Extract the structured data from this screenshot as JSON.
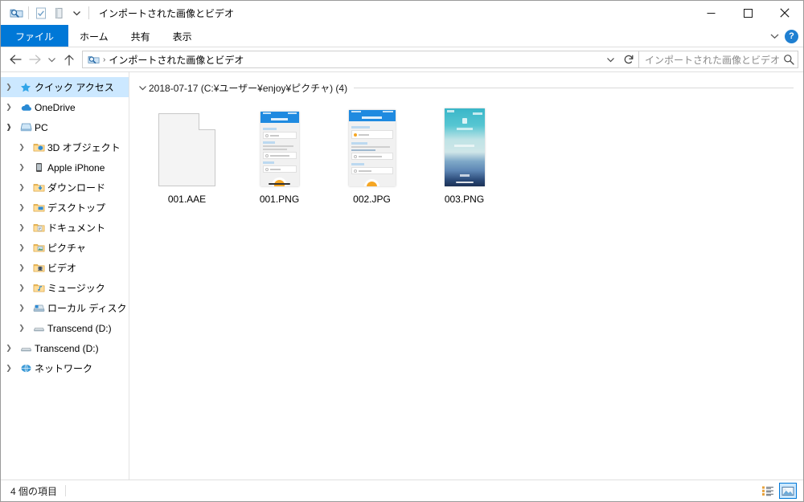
{
  "window": {
    "title": "インポートされた画像とビデオ",
    "quick_access_icons": [
      "saved-search-folder-icon",
      "properties-icon",
      "new-folder-icon",
      "customize-dropdown-icon"
    ],
    "controls": {
      "minimize": "minimize-button",
      "maximize": "maximize-button",
      "close": "close-button"
    }
  },
  "ribbon": {
    "tabs": [
      {
        "label": "ファイル",
        "active": true
      },
      {
        "label": "ホーム",
        "active": false
      },
      {
        "label": "共有",
        "active": false
      },
      {
        "label": "表示",
        "active": false
      }
    ],
    "collapse_label": "",
    "help_label": "?"
  },
  "address": {
    "back": "戻る",
    "forward": "進む",
    "recent": "最近表示した場所",
    "up": "上へ",
    "crumb_icon": "saved-search-folder-icon",
    "crumb_separator": "›",
    "path": "インポートされた画像とビデオ",
    "dropdown": "⌄",
    "refresh": "↻"
  },
  "search": {
    "placeholder": "インポートされた画像とビデオの検索",
    "icon": "search-icon"
  },
  "sidebar": {
    "items": [
      {
        "label": "クイック アクセス",
        "icon": "star-icon",
        "level": 1,
        "expanded": false,
        "selected": true
      },
      {
        "label": "OneDrive",
        "icon": "onedrive-cloud-icon",
        "level": 1,
        "expanded": false,
        "selected": false
      },
      {
        "label": "PC",
        "icon": "pc-icon",
        "level": 1,
        "expanded": true,
        "selected": false
      },
      {
        "label": "3D オブジェクト",
        "icon": "folder-3d-icon",
        "level": 2,
        "expanded": false,
        "selected": false
      },
      {
        "label": "Apple iPhone",
        "icon": "phone-icon",
        "level": 2,
        "expanded": false,
        "selected": false
      },
      {
        "label": "ダウンロード",
        "icon": "downloads-folder-icon",
        "level": 2,
        "expanded": false,
        "selected": false
      },
      {
        "label": "デスクトップ",
        "icon": "desktop-folder-icon",
        "level": 2,
        "expanded": false,
        "selected": false
      },
      {
        "label": "ドキュメント",
        "icon": "documents-folder-icon",
        "level": 2,
        "expanded": false,
        "selected": false
      },
      {
        "label": "ピクチャ",
        "icon": "pictures-folder-icon",
        "level": 2,
        "expanded": false,
        "selected": false
      },
      {
        "label": "ビデオ",
        "icon": "videos-folder-icon",
        "level": 2,
        "expanded": false,
        "selected": false
      },
      {
        "label": "ミュージック",
        "icon": "music-folder-icon",
        "level": 2,
        "expanded": false,
        "selected": false
      },
      {
        "label": "ローカル ディスク (C:)",
        "icon": "hard-drive-icon",
        "level": 2,
        "expanded": false,
        "selected": false
      },
      {
        "label": "Transcend (D:)",
        "icon": "removable-drive-icon",
        "level": 2,
        "expanded": false,
        "selected": false
      },
      {
        "label": "Transcend (D:)",
        "icon": "removable-drive-icon",
        "level": 1,
        "expanded": false,
        "selected": false
      },
      {
        "label": "ネットワーク",
        "icon": "network-icon",
        "level": 1,
        "expanded": false,
        "selected": false
      }
    ]
  },
  "content": {
    "group": {
      "label": "2018-07-17 (C:¥ユーザー¥enjoy¥ピクチャ) (4)",
      "expanded": true
    },
    "files": [
      {
        "name": "001.AAE",
        "kind": "generic-file"
      },
      {
        "name": "001.PNG",
        "kind": "phone-screenshot-form"
      },
      {
        "name": "002.JPG",
        "kind": "phone-screenshot-form2"
      },
      {
        "name": "003.PNG",
        "kind": "phone-lockscreen"
      }
    ]
  },
  "status": {
    "count_label": "4 個の項目",
    "views": [
      {
        "name": "details-view",
        "active": false
      },
      {
        "name": "large-icons-view",
        "active": true
      }
    ]
  },
  "colors": {
    "accent": "#0078d7",
    "selection": "#cce8ff",
    "hover": "#e5f3ff",
    "app_header_blue": "#1f8ae0",
    "fab_orange": "#f5a623"
  }
}
